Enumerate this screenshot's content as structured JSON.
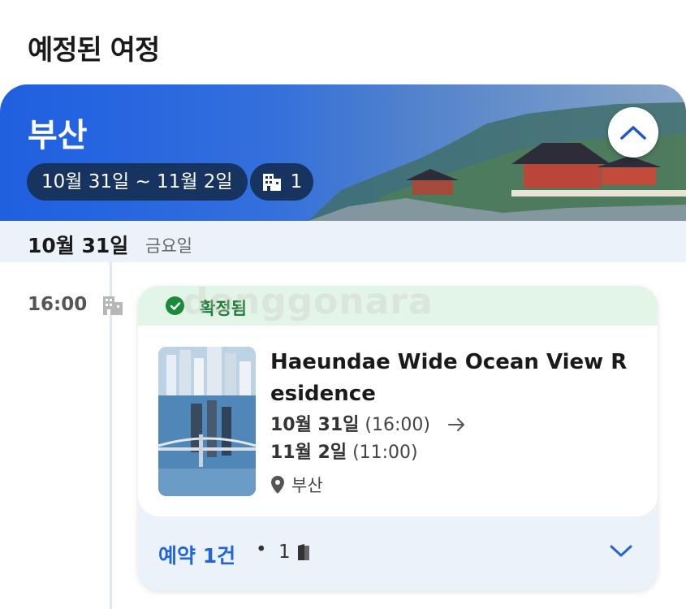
{
  "page": {
    "title": "예정된 여정"
  },
  "trip": {
    "city": "부산",
    "date_range": "10월 31일 ~ 11월 2일",
    "hotel_count": "1"
  },
  "day": {
    "date": "10월 31일",
    "weekday": "금요일"
  },
  "stay": {
    "time": "16:00",
    "status": "확정됨",
    "hotel_name": "Haeundae Wide Ocean View Residence",
    "checkin_date": "10월 31일",
    "checkin_time": "(16:00)",
    "checkout_date": "11월 2일",
    "checkout_time": "(11:00)",
    "location": "부산"
  },
  "footer": {
    "booking_count": "예약 1건",
    "separator": "•",
    "room_count": "1"
  },
  "watermark": "donggonara",
  "colors": {
    "accent": "#2165d8",
    "hero": "#2060e0",
    "pill": "#17335f",
    "confirmed": "#1b8a3a"
  }
}
